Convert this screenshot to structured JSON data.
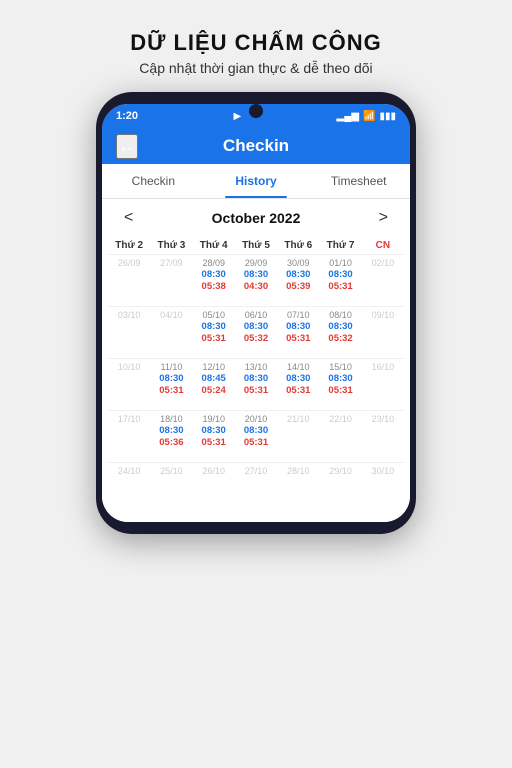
{
  "header": {
    "title": "DỮ LIỆU CHẤM CÔNG",
    "subtitle": "Cập nhật thời gian thực & dễ theo dõi"
  },
  "status_bar": {
    "time": "1:20",
    "navigation_icon": "▶",
    "signal": "▂▄▆",
    "wifi": "wifi",
    "battery": "▮▮▮"
  },
  "app_bar": {
    "back_icon": "←",
    "title": "Checkin"
  },
  "tabs": [
    {
      "label": "Checkin",
      "active": false
    },
    {
      "label": "History",
      "active": true
    },
    {
      "label": "Timesheet",
      "active": false
    }
  ],
  "calendar": {
    "month_label": "October 2022",
    "prev_icon": "<",
    "next_icon": ">",
    "days_of_week": [
      "Thứ 2",
      "Thứ 3",
      "Thứ 4",
      "Thứ 5",
      "Thứ 6",
      "Thứ 7",
      "CN"
    ],
    "weeks": [
      [
        {
          "date": "26/09",
          "in": "",
          "out": ""
        },
        {
          "date": "27/09",
          "in": "",
          "out": ""
        },
        {
          "date": "28/09",
          "in": "08:30",
          "out": "05:38"
        },
        {
          "date": "29/09",
          "in": "08:30",
          "out": "04:30"
        },
        {
          "date": "30/09",
          "in": "08:30",
          "out": "05:39"
        },
        {
          "date": "01/10",
          "in": "08:30",
          "out": "05:31"
        },
        {
          "date": "02/10",
          "in": "",
          "out": ""
        }
      ],
      [
        {
          "date": "03/10",
          "in": "",
          "out": ""
        },
        {
          "date": "04/10",
          "in": "",
          "out": ""
        },
        {
          "date": "05/10",
          "in": "08:30",
          "out": "05:31"
        },
        {
          "date": "06/10",
          "in": "08:30",
          "out": "05:32"
        },
        {
          "date": "07/10",
          "in": "08:30",
          "out": "05:31"
        },
        {
          "date": "08/10",
          "in": "08:30",
          "out": "05:32"
        },
        {
          "date": "09/10",
          "in": "",
          "out": ""
        }
      ],
      [
        {
          "date": "10/10",
          "in": "",
          "out": ""
        },
        {
          "date": "11/10",
          "in": "08:30",
          "out": "05:31"
        },
        {
          "date": "12/10",
          "in": "08:45",
          "out": "05:24"
        },
        {
          "date": "13/10",
          "in": "08:30",
          "out": "05:31"
        },
        {
          "date": "14/10",
          "in": "08:30",
          "out": "05:31"
        },
        {
          "date": "15/10",
          "in": "08:30",
          "out": "05:31"
        },
        {
          "date": "16/10",
          "in": "",
          "out": ""
        }
      ],
      [
        {
          "date": "17/10",
          "in": "",
          "out": ""
        },
        {
          "date": "18/10",
          "in": "08:30",
          "out": "05:36"
        },
        {
          "date": "19/10",
          "in": "08:30",
          "out": "05:31"
        },
        {
          "date": "20/10",
          "in": "08:30",
          "out": "05:31"
        },
        {
          "date": "21/10",
          "in": "",
          "out": ""
        },
        {
          "date": "22/10",
          "in": "",
          "out": ""
        },
        {
          "date": "23/10",
          "in": "",
          "out": ""
        }
      ],
      [
        {
          "date": "24/10",
          "in": "",
          "out": ""
        },
        {
          "date": "25/10",
          "in": "",
          "out": ""
        },
        {
          "date": "26/10",
          "in": "",
          "out": ""
        },
        {
          "date": "27/10",
          "in": "",
          "out": ""
        },
        {
          "date": "28/10",
          "in": "",
          "out": ""
        },
        {
          "date": "29/10",
          "in": "",
          "out": ""
        },
        {
          "date": "30/10",
          "in": "",
          "out": ""
        }
      ]
    ]
  }
}
